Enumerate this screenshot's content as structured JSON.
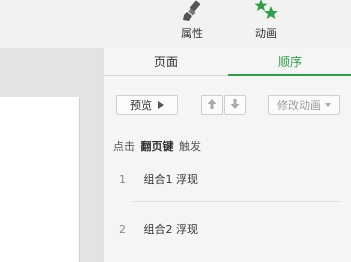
{
  "ribbon": {
    "attributes_label": "属性",
    "animation_label": "动画"
  },
  "panel": {
    "tabs": [
      {
        "label": "页面",
        "active": false
      },
      {
        "label": "顺序",
        "active": true
      }
    ],
    "preview_label": "预览",
    "modify_label": "修改动画",
    "trigger": {
      "prefix": "点击",
      "key": "翻页键",
      "suffix": "触发"
    },
    "items": [
      {
        "number": "1",
        "label": "组合1 浮现"
      },
      {
        "number": "2",
        "label": "组合2 浮现"
      }
    ]
  },
  "colors": {
    "accent": "#2aa146",
    "icon_grey": "#555555"
  },
  "icons": [
    "brush-icon",
    "stars-icon",
    "play-icon",
    "arrow-up-icon",
    "arrow-down-icon",
    "chevron-down-icon"
  ]
}
